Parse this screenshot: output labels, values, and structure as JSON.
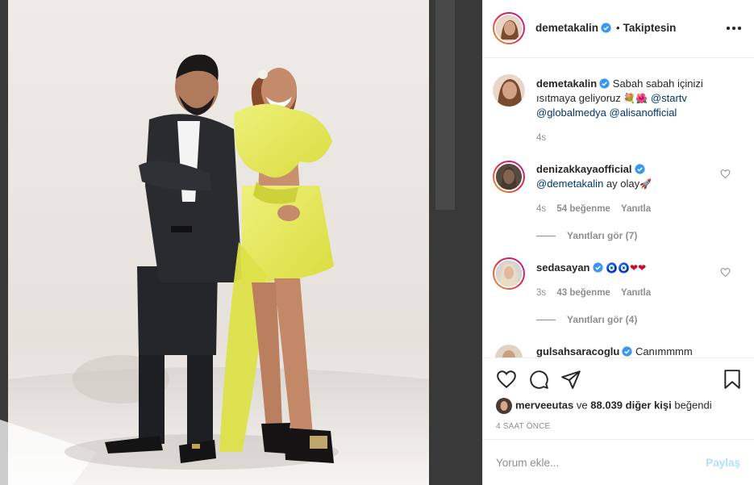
{
  "post": {
    "author": "demetakalin",
    "follow_separator": "•",
    "follow_status": "Takiptesin",
    "caption_text": "Sabah sabah içinizi ısıtmaya geliyoruz",
    "caption_emojis": "💐🌺",
    "caption_mentions": [
      "@startv",
      "@globalmedya",
      "@alisanofficial"
    ],
    "caption_time": "4s",
    "liked_by_user": "merveeutas",
    "liked_by_connector": "ve",
    "liked_by_count": "88.039 diğer kişi",
    "liked_by_suffix": "beğendi",
    "time_ago": "4 SAAT ÖNCE"
  },
  "comments": [
    {
      "user": "denizakkayaofficial",
      "mention": "@demetakalin",
      "text": "ay olay",
      "emoji": "🚀",
      "time": "4s",
      "likes": "54 beğenme",
      "reply": "Yanıtla",
      "view_replies": "Yanıtları gör (7)"
    },
    {
      "user": "sedasayan",
      "emoji": "🧿🧿❤❤",
      "time": "3s",
      "likes": "43 beğenme",
      "reply": "Yanıtla",
      "view_replies": "Yanıtları gör (4)"
    },
    {
      "user": "gulsahsaracoglu",
      "text": "Canımmmm"
    }
  ],
  "comment_box": {
    "placeholder": "Yorum ekle...",
    "post_label": "Paylaş"
  },
  "colors": {
    "verified": "#3897f0",
    "mention": "#00376b",
    "post_disabled": "#b2dffc",
    "dress": "#e7ec5c"
  },
  "icons": [
    "heart-icon",
    "comment-icon",
    "share-icon",
    "bookmark-icon",
    "more-options-icon",
    "verified-icon"
  ]
}
